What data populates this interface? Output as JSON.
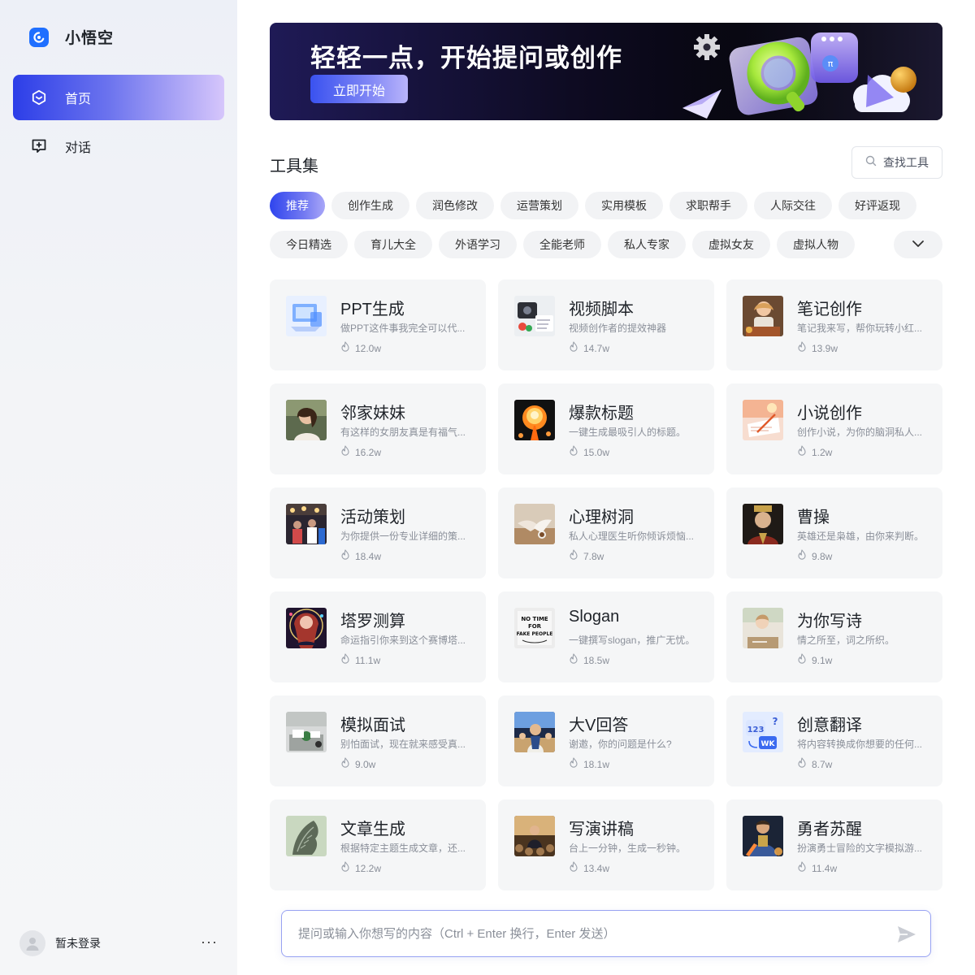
{
  "brand": {
    "name": "小悟空",
    "logo_icon": "app-logo-icon",
    "accent": "#1f6fff"
  },
  "sidebar": {
    "items": [
      {
        "label": "首页",
        "icon": "home-hexagon-icon",
        "active": true
      },
      {
        "label": "对话",
        "icon": "chat-plus-icon",
        "active": false
      }
    ],
    "user": {
      "name": "暂未登录",
      "avatar_icon": "user-avatar-icon",
      "more_label": "···"
    }
  },
  "banner": {
    "title": "轻轻一点，开始提问或创作",
    "button_label": "立即开始"
  },
  "tools": {
    "title": "工具集",
    "search_label": "查找工具",
    "categories_row1": [
      "推荐",
      "创作生成",
      "润色修改",
      "运营策划",
      "实用模板",
      "求职帮手",
      "人际交往",
      "好评返现"
    ],
    "categories_row2": [
      "今日精选",
      "育儿大全",
      "外语学习",
      "全能老师",
      "私人专家",
      "虚拟女友",
      "虚拟人物"
    ],
    "active_category": "推荐",
    "cards": [
      {
        "title": "PPT生成",
        "desc": "做PPT这件事我完全可以代...",
        "count": "12.0w",
        "thumb": "ppt-thumb"
      },
      {
        "title": "视频脚本",
        "desc": "视频创作者的提效神器",
        "count": "14.7w",
        "thumb": "video-script-thumb"
      },
      {
        "title": "笔记创作",
        "desc": "笔记我来写，帮你玩转小红...",
        "count": "13.9w",
        "thumb": "note-thumb"
      },
      {
        "title": "邻家妹妹",
        "desc": "有这样的女朋友真是有福气...",
        "count": "16.2w",
        "thumb": "girl-thumb"
      },
      {
        "title": "爆款标题",
        "desc": "一键生成最吸引人的标题。",
        "count": "15.0w",
        "thumb": "explosion-thumb"
      },
      {
        "title": "小说创作",
        "desc": "创作小说，为你的脑洞私人...",
        "count": "1.2w",
        "thumb": "novel-thumb"
      },
      {
        "title": "活动策划",
        "desc": "为你提供一份专业详细的策...",
        "count": "18.4w",
        "thumb": "event-thumb"
      },
      {
        "title": "心理树洞",
        "desc": "私人心理医生听你倾诉烦恼...",
        "count": "7.8w",
        "thumb": "therapy-thumb"
      },
      {
        "title": "曹操",
        "desc": "英雄还是枭雄，由你来判断。",
        "count": "9.8w",
        "thumb": "caocao-thumb"
      },
      {
        "title": "塔罗测算",
        "desc": "命运指引你来到这个赛博塔...",
        "count": "11.1w",
        "thumb": "tarot-thumb"
      },
      {
        "title": "Slogan",
        "desc": "一键撰写slogan，推广无忧。",
        "count": "18.5w",
        "thumb": "slogan-thumb"
      },
      {
        "title": "为你写诗",
        "desc": "情之所至，词之所织。",
        "count": "9.1w",
        "thumb": "poem-thumb"
      },
      {
        "title": "模拟面试",
        "desc": "别怕面试，现在就来感受真...",
        "count": "9.0w",
        "thumb": "interview-thumb"
      },
      {
        "title": "大V回答",
        "desc": "谢邀，你的问题是什么?",
        "count": "18.1w",
        "thumb": "influencer-thumb"
      },
      {
        "title": "创意翻译",
        "desc": "将内容转换成你想要的任何...",
        "count": "8.7w",
        "thumb": "translate-thumb"
      },
      {
        "title": "文章生成",
        "desc": "根据特定主题生成文章，还...",
        "count": "12.2w",
        "thumb": "article-thumb"
      },
      {
        "title": "写演讲稿",
        "desc": "台上一分钟，生成一秒钟。",
        "count": "13.4w",
        "thumb": "speech-thumb"
      },
      {
        "title": "勇者苏醒",
        "desc": "扮演勇士冒险的文字模拟游...",
        "count": "11.4w",
        "thumb": "hero-thumb"
      }
    ],
    "thumb_texts": {
      "slogan": [
        "NO TIME",
        "FOR",
        "FAKE PEOPLE"
      ],
      "translate": [
        "123",
        "?",
        "WK"
      ]
    }
  },
  "prompt": {
    "placeholder": "提问或输入你想写的内容（Ctrl + Enter 换行，Enter 发送）",
    "value": "",
    "send_icon": "send-icon"
  }
}
